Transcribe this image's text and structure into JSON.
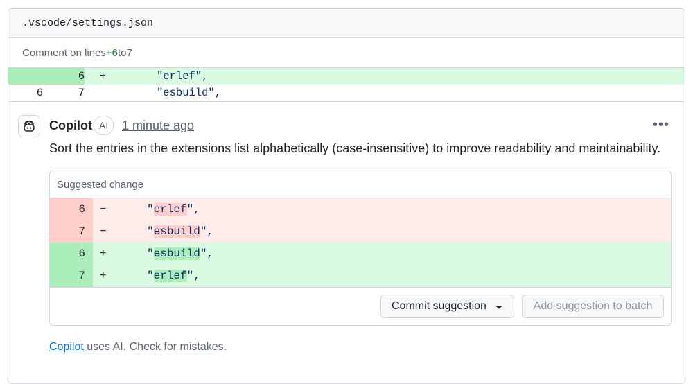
{
  "file": {
    "path": ".vscode/settings.json"
  },
  "comment_on": {
    "prefix": "Comment on lines ",
    "start": "+6",
    "middle": " to ",
    "end": "7"
  },
  "context_lines": [
    {
      "old": "",
      "new": "6",
      "sign": "+",
      "code": "\"erlef\",",
      "type": "added"
    },
    {
      "old": "6",
      "new": "7",
      "sign": "",
      "code": "\"esbuild\",",
      "type": "context"
    }
  ],
  "comment": {
    "author": "Copilot",
    "badge": "AI",
    "time": "1 minute ago",
    "more": "•••",
    "body": "Sort the entries in the extensions list alphabetically (case-insensitive) to improve readability and maintainability.",
    "avatar_icon": "copilot-icon"
  },
  "suggestion": {
    "title": "Suggested change",
    "lines": [
      {
        "num": "6",
        "sign": "−",
        "before": "\"",
        "word": "erlef",
        "after": "\",",
        "type": "del"
      },
      {
        "num": "7",
        "sign": "−",
        "before": "\"",
        "word": "esbuild",
        "after": "\",",
        "type": "del"
      },
      {
        "num": "6",
        "sign": "+",
        "before": "\"",
        "word": "esbuild",
        "after": "\",",
        "type": "ins"
      },
      {
        "num": "7",
        "sign": "+",
        "before": "\"",
        "word": "erlef",
        "after": "\",",
        "type": "ins"
      }
    ],
    "commit_label": "Commit suggestion",
    "batch_label": "Add suggestion to batch"
  },
  "footnote": {
    "link": "Copilot",
    "text": " uses AI. Check for mistakes."
  },
  "colors": {
    "added_bg": "#dafbe1",
    "added_gutter": "#aceebb",
    "deleted_bg": "#ffebe9",
    "deleted_gutter": "#ffcecb",
    "link": "#0969da"
  }
}
